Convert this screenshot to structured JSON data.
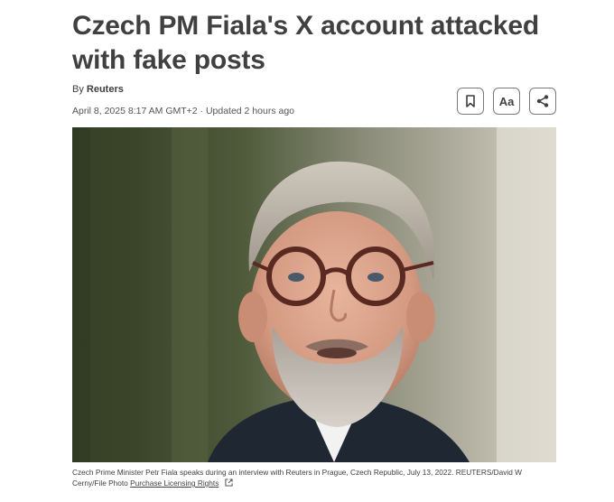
{
  "article": {
    "headline": "Czech PM Fiala's X account attacked with fake posts",
    "byline_prefix": "By",
    "author": "Reuters",
    "dateline": "April 8, 2025 8:17 AM GMT+2 · Updated 2 hours ago"
  },
  "tools": {
    "text_size_label": "Aa",
    "icons": [
      "bookmark-icon",
      "text-size-icon",
      "share-icon"
    ]
  },
  "photo": {
    "caption": "Czech Prime Minister Petr Fiala speaks during an interview with Reuters in Prague, Czech Republic, July 13, 2022. REUTERS/David W Cerny/File Photo",
    "license_link": "Purchase Licensing Rights"
  },
  "colors": {
    "text": "#404040",
    "border": "#7a7a7a",
    "background": "#ffffff"
  }
}
